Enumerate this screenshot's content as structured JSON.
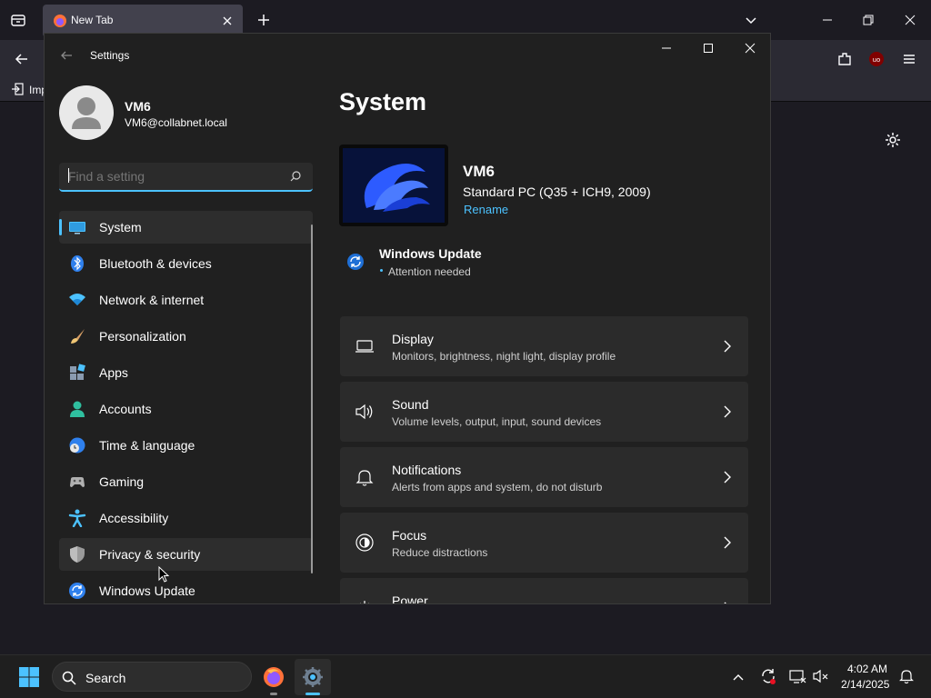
{
  "browser": {
    "tab_title": "New Tab",
    "bookmark_label": "Imp"
  },
  "settings": {
    "window_title": "Settings",
    "user": {
      "name": "VM6",
      "email": "VM6@collabnet.local"
    },
    "search": {
      "placeholder": "Find a setting"
    },
    "nav": [
      {
        "label": "System",
        "icon": "monitor-icon",
        "selected": true
      },
      {
        "label": "Bluetooth & devices",
        "icon": "bluetooth-icon"
      },
      {
        "label": "Network & internet",
        "icon": "wifi-icon"
      },
      {
        "label": "Personalization",
        "icon": "brush-icon"
      },
      {
        "label": "Apps",
        "icon": "apps-icon"
      },
      {
        "label": "Accounts",
        "icon": "person-icon"
      },
      {
        "label": "Time & language",
        "icon": "globe-clock-icon"
      },
      {
        "label": "Gaming",
        "icon": "gamepad-icon"
      },
      {
        "label": "Accessibility",
        "icon": "accessibility-icon"
      },
      {
        "label": "Privacy & security",
        "icon": "shield-icon",
        "hovered": true
      },
      {
        "label": "Windows Update",
        "icon": "update-icon"
      }
    ],
    "page_title": "System",
    "device": {
      "name": "VM6",
      "model": "Standard PC (Q35 + ICH9, 2009)",
      "rename_label": "Rename"
    },
    "update": {
      "title": "Windows Update",
      "status": "Attention needed"
    },
    "cards": [
      {
        "title": "Display",
        "subtitle": "Monitors, brightness, night light, display profile",
        "icon": "display-icon"
      },
      {
        "title": "Sound",
        "subtitle": "Volume levels, output, input, sound devices",
        "icon": "speaker-icon"
      },
      {
        "title": "Notifications",
        "subtitle": "Alerts from apps and system, do not disturb",
        "icon": "bell-icon"
      },
      {
        "title": "Focus",
        "subtitle": "Reduce distractions",
        "icon": "focus-icon"
      },
      {
        "title": "Power",
        "subtitle": "",
        "icon": "power-icon"
      }
    ]
  },
  "taskbar": {
    "search_placeholder": "Search",
    "time": "4:02 AM",
    "date": "2/14/2025"
  },
  "colors": {
    "accent": "#4cc2ff",
    "window_bg": "#202020",
    "card_bg": "#2b2b2b",
    "selected_nav_bg": "#2d2d2d"
  }
}
